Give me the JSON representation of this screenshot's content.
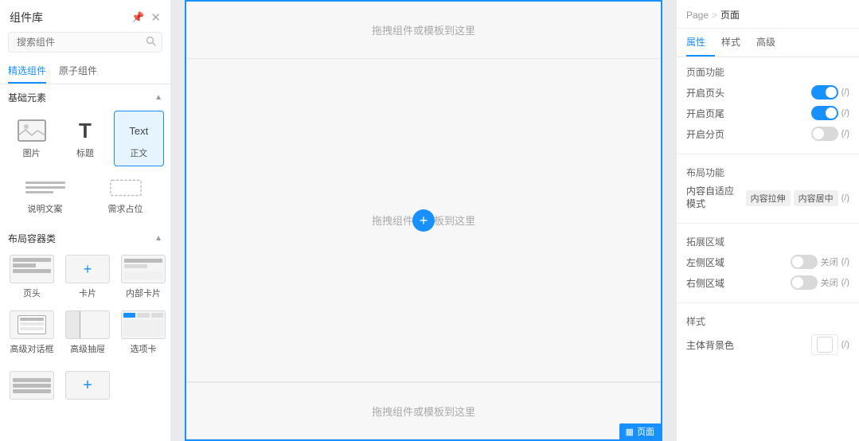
{
  "leftPanel": {
    "title": "组件库",
    "searchPlaceholder": "搜索组件",
    "tabs": [
      {
        "label": "精选组件",
        "active": true
      },
      {
        "label": "原子组件",
        "active": false
      }
    ],
    "sections": [
      {
        "name": "基础元素",
        "collapsed": false,
        "components": [
          {
            "id": "image",
            "label": "图片",
            "type": "image"
          },
          {
            "id": "title",
            "label": "标题",
            "type": "text-t"
          },
          {
            "id": "text",
            "label": "正文",
            "type": "text-label"
          },
          {
            "id": "desc",
            "label": "说明文案",
            "type": "desc"
          },
          {
            "id": "placeholder",
            "label": "需求占位",
            "type": "placeholder"
          }
        ]
      },
      {
        "name": "布局容器类",
        "collapsed": false,
        "components": [
          {
            "id": "header",
            "label": "页头",
            "type": "layout-header"
          },
          {
            "id": "card",
            "label": "卡片",
            "type": "layout-card"
          },
          {
            "id": "inner-card",
            "label": "内部卡片",
            "type": "layout-inner-card"
          },
          {
            "id": "dialog",
            "label": "高级对话框",
            "type": "layout-dialog"
          },
          {
            "id": "drawer",
            "label": "高级抽屉",
            "type": "layout-drawer"
          },
          {
            "id": "tabs",
            "label": "选项卡",
            "type": "layout-tabs"
          }
        ]
      }
    ],
    "moreItems": [
      {
        "id": "list",
        "label": "",
        "type": "list-rows"
      },
      {
        "id": "add",
        "label": "",
        "type": "plus-center"
      }
    ]
  },
  "canvas": {
    "dropZoneText": "拖拽组件或模板到这里",
    "addButtonSymbol": "+",
    "pageBadge": "页面",
    "pageIconSymbol": "▦"
  },
  "rightPanel": {
    "breadcrumb": {
      "parent": "Page",
      "separator": ">",
      "current": "页面"
    },
    "tabs": [
      {
        "label": "属性",
        "active": true
      },
      {
        "label": "样式",
        "active": false
      },
      {
        "label": "高级",
        "active": false
      }
    ],
    "pageFunctions": {
      "title": "页面功能",
      "rows": [
        {
          "label": "开启页头",
          "toggle": true,
          "toggleLabel": "(/)"
        },
        {
          "label": "开启页尾",
          "toggle": true,
          "toggleLabel": "(/)"
        },
        {
          "label": "开启分页",
          "toggle": false,
          "toggleLabel": "(/)"
        }
      ]
    },
    "layoutFunctions": {
      "title": "布局功能",
      "rows": [
        {
          "label": "内容自适应模式",
          "tags": [
            "内容拉伸",
            "内容居中"
          ],
          "suffix": "(/)"
        }
      ]
    },
    "expandAreas": {
      "title": "拓展区域",
      "rows": [
        {
          "label": "左侧区域",
          "toggle": false,
          "toggleLabel": "关闭",
          "suffix": "(/)"
        },
        {
          "label": "右侧区域",
          "toggle": false,
          "toggleLabel": "关闭",
          "suffix": "(/)"
        }
      ]
    },
    "styles": {
      "title": "样式",
      "rows": [
        {
          "label": "主体背景色",
          "type": "color",
          "suffix": "(/)"
        }
      ]
    }
  }
}
